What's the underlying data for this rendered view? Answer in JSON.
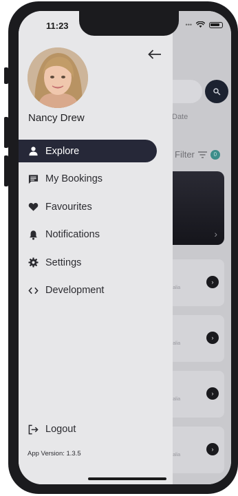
{
  "status_bar": {
    "time": "11:23"
  },
  "drawer": {
    "user_name": "Nancy Drew",
    "menu": [
      {
        "label": "Explore",
        "icon": "person-icon",
        "active": true
      },
      {
        "label": "My Bookings",
        "icon": "message-icon",
        "active": false
      },
      {
        "label": "Favourites",
        "icon": "heart-icon",
        "active": false
      },
      {
        "label": "Notifications",
        "icon": "bell-icon",
        "active": false
      },
      {
        "label": "Settings",
        "icon": "gear-icon",
        "active": false
      },
      {
        "label": "Development",
        "icon": "code-icon",
        "active": false
      }
    ],
    "logout_label": "Logout",
    "app_version": "App Version: 1.3.5"
  },
  "background": {
    "date_label": "Date",
    "filter_label": "Filter",
    "filter_count": "0",
    "card_location": "tralia"
  },
  "colors": {
    "accent": "#262838",
    "drawer_bg": "#e7e7e9",
    "badge": "#3d8d8a"
  }
}
